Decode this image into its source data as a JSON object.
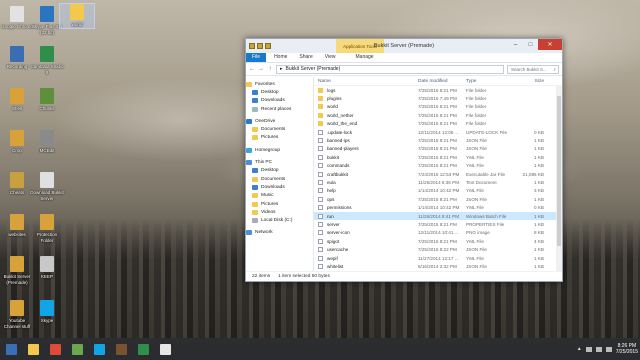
{
  "desktop": {
    "icons": [
      {
        "label": "Google Chrome",
        "color": "#e2e2e2"
      },
      {
        "label": "Skype Plus 3.0 (32 bit)",
        "color": "#2a74c0"
      },
      {
        "label": "world",
        "color": "#f2c94c"
      },
      {
        "label": "Recording",
        "color": "#3b6db3"
      },
      {
        "label": "Camtasia Studio 8",
        "color": "#2f8f4a"
      },
      {
        "label": "Shell",
        "color": "#d8a23a"
      },
      {
        "label": "Chunks",
        "color": "#5e8f3a"
      },
      {
        "label": "Crop",
        "color": "#d8a23a"
      },
      {
        "label": "MCEdit",
        "color": "#8a8a8a"
      },
      {
        "label": "Cheats",
        "color": "#c9a040"
      },
      {
        "label": "Download Bukkit Server",
        "color": "#e0e0e0"
      },
      {
        "label": "websites",
        "color": "#d8a23a"
      },
      {
        "label": "Protection Folder",
        "color": "#d8a23a"
      },
      {
        "label": "Bukkit Server (Premade)",
        "color": "#d8a23a"
      },
      {
        "label": "KEEP",
        "color": "#c8c8c8"
      },
      {
        "label": "Youtube Channel stuff",
        "color": "#d8a23a"
      },
      {
        "label": "Skype",
        "color": "#12a5e6"
      }
    ]
  },
  "window": {
    "app_tools_label": "Application Tools",
    "title": "Bukkit Server (Premade)",
    "minimize": "–",
    "maximize": "□",
    "close": "✕",
    "ribbon_tabs": [
      "File",
      "Home",
      "Share",
      "View",
      "Manage"
    ],
    "address": {
      "back": "←",
      "forward": "→",
      "up": "↑",
      "path_root": "▸",
      "path": "Bukkit Server (Premade)",
      "search_placeholder": "Search Bukkit S...",
      "search_icon": "search-icon"
    },
    "nav": {
      "favorites": "Favorites",
      "desktop": "Desktop",
      "downloads": "Downloads",
      "recent": "Recent places",
      "onedrive": "OneDrive",
      "documents": "Documents",
      "pictures": "Pictures",
      "homegroup": "Homegroup",
      "thispc": "This PC",
      "pc_desktop": "Desktop",
      "pc_documents": "Documents",
      "pc_downloads": "Downloads",
      "pc_music": "Music",
      "pc_pictures": "Pictures",
      "pc_videos": "Videos",
      "localdisk": "Local Disk (C:)",
      "network": "Network"
    },
    "columns": {
      "name": "Name",
      "date": "Date modified",
      "type": "Type",
      "size": "Size"
    },
    "files": [
      {
        "name": "logs",
        "date": "7/25/2015 8:21 PM",
        "type": "File folder",
        "size": "",
        "kind": "folder"
      },
      {
        "name": "plugins",
        "date": "7/25/2015 7:49 PM",
        "type": "File folder",
        "size": "",
        "kind": "folder"
      },
      {
        "name": "world",
        "date": "7/25/2015 8:21 PM",
        "type": "File folder",
        "size": "",
        "kind": "folder"
      },
      {
        "name": "world_nether",
        "date": "7/25/2015 8:21 PM",
        "type": "File folder",
        "size": "",
        "kind": "folder"
      },
      {
        "name": "world_the_end",
        "date": "7/25/2015 8:21 PM",
        "type": "File folder",
        "size": "",
        "kind": "folder"
      },
      {
        "name": ".update-lock",
        "date": "12/11/2014 12:08 ...",
        "type": "UPDATE-LOCK File",
        "size": "0 KB",
        "kind": "file"
      },
      {
        "name": "banned-ips",
        "date": "7/25/2015 8:21 PM",
        "type": "JSON File",
        "size": "1 KB",
        "kind": "file"
      },
      {
        "name": "banned-players",
        "date": "7/25/2015 8:21 PM",
        "type": "JSON File",
        "size": "1 KB",
        "kind": "file"
      },
      {
        "name": "bukkit",
        "date": "7/25/2015 8:21 PM",
        "type": "YML File",
        "size": "1 KB",
        "kind": "file"
      },
      {
        "name": "commands",
        "date": "7/25/2015 8:21 PM",
        "type": "YML File",
        "size": "1 KB",
        "kind": "file"
      },
      {
        "name": "craftbukkit",
        "date": "7/24/2015 12:53 PM",
        "type": "Executable Jar File",
        "size": "21,085 KB",
        "kind": "file"
      },
      {
        "name": "eula",
        "date": "11/26/2014 8:36 PM",
        "type": "Text Document",
        "size": "1 KB",
        "kind": "file"
      },
      {
        "name": "help",
        "date": "1/14/2014 10:42 PM",
        "type": "YML File",
        "size": "3 KB",
        "kind": "file"
      },
      {
        "name": "ops",
        "date": "7/25/2015 8:21 PM",
        "type": "JSON File",
        "size": "1 KB",
        "kind": "file"
      },
      {
        "name": "permissions",
        "date": "1/14/2014 10:42 PM",
        "type": "YML File",
        "size": "0 KB",
        "kind": "file"
      },
      {
        "name": "run",
        "date": "11/26/2014 8:41 PM",
        "type": "Windows Batch File",
        "size": "1 KB",
        "kind": "file",
        "selected": true
      },
      {
        "name": "server",
        "date": "7/25/2015 8:21 PM",
        "type": "PROPERTIES File",
        "size": "1 KB",
        "kind": "file"
      },
      {
        "name": "server-icon",
        "date": "12/11/2014 10:41 ...",
        "type": "PNG image",
        "size": "8 KB",
        "kind": "file"
      },
      {
        "name": "spigot",
        "date": "7/25/2015 8:21 PM",
        "type": "YML File",
        "size": "4 KB",
        "kind": "file"
      },
      {
        "name": "usercache",
        "date": "7/25/2015 8:22 PM",
        "type": "JSON File",
        "size": "1 KB",
        "kind": "file"
      },
      {
        "name": "wepif",
        "date": "11/27/2014 12:17 ...",
        "type": "YML File",
        "size": "1 KB",
        "kind": "file"
      },
      {
        "name": "whitelist",
        "date": "6/16/2014 2:32 PM",
        "type": "JSON File",
        "size": "1 KB",
        "kind": "file"
      }
    ],
    "status": {
      "count": "22 items",
      "selection": "1 item selected  50 bytes"
    }
  },
  "taskbar": {
    "items": [
      {
        "name": "start-button",
        "color": "#3a6fb5"
      },
      {
        "name": "file-explorer",
        "color": "#f2c94c"
      },
      {
        "name": "chrome",
        "color": "#dd4b39"
      },
      {
        "name": "minecraft",
        "color": "#6aa84f"
      },
      {
        "name": "skype",
        "color": "#12a5e6"
      },
      {
        "name": "minecraft-2",
        "color": "#7a5230"
      },
      {
        "name": "camtasia",
        "color": "#2f8f4a"
      },
      {
        "name": "app-white",
        "color": "#e6e6e6"
      }
    ],
    "clock": {
      "time": "8:26 PM",
      "date": "7/25/2015"
    }
  }
}
